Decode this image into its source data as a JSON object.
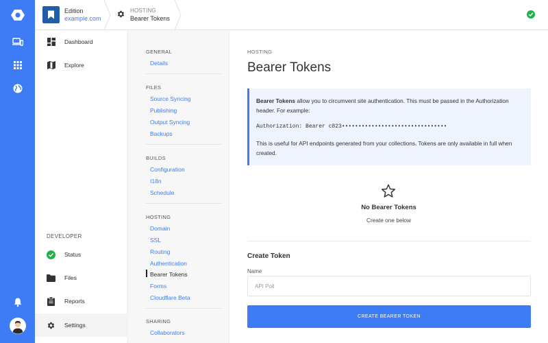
{
  "rail": {
    "icons": [
      "logo-icon",
      "devices-icon",
      "grid-icon",
      "globe-icon",
      "bell-icon",
      "avatar"
    ]
  },
  "topbar": {
    "site_name": "Edition",
    "site_url": "example.com",
    "crumb_section": "HOSTING",
    "crumb_page": "Bearer Tokens",
    "status": "ok"
  },
  "nav": {
    "top_items": [
      {
        "label": "Dashboard",
        "icon": "dashboard-icon"
      },
      {
        "label": "Explore",
        "icon": "map-icon"
      }
    ],
    "developer_heading": "DEVELOPER",
    "developer_items": [
      {
        "label": "Status",
        "icon": "check-circle-icon"
      },
      {
        "label": "Files",
        "icon": "folder-icon"
      },
      {
        "label": "Reports",
        "icon": "clipboard-icon"
      },
      {
        "label": "Settings",
        "icon": "gear-icon",
        "active": true
      }
    ]
  },
  "settings": {
    "groups": [
      {
        "heading": "GENERAL",
        "links": [
          "Details"
        ]
      },
      {
        "heading": "FILES",
        "links": [
          "Source Syncing",
          "Publishing",
          "Output Syncing",
          "Backups"
        ]
      },
      {
        "heading": "BUILDS",
        "links": [
          "Configuration",
          "I18n",
          "Schedule"
        ]
      },
      {
        "heading": "HOSTING",
        "links": [
          "Domain",
          "SSL",
          "Routing",
          "Authentication",
          "Bearer Tokens",
          "Forms",
          "Cloudflare Beta"
        ]
      },
      {
        "heading": "SHARING",
        "links": [
          "Collaborators"
        ]
      }
    ],
    "current": "Bearer Tokens"
  },
  "main": {
    "section": "HOSTING",
    "title": "Bearer Tokens",
    "notice": {
      "bold": "Bearer Tokens",
      "text1": " allow you to circumvent site authentication. This must be passed in the Authorization header. For example:",
      "code": "Authorization: Bearer c823••••••••••••••••••••••••••••••••",
      "text2": "This is useful for API endpoints generated from your collections. Tokens are only available in full when created."
    },
    "empty": {
      "icon": "star-icon",
      "title": "No Bearer Tokens",
      "subtitle": "Create one below"
    },
    "create": {
      "title": "Create Token",
      "name_label": "Name",
      "name_placeholder": "API Poll",
      "button": "CREATE BEARER TOKEN"
    }
  },
  "colors": {
    "accent": "#3d7cf4",
    "success": "#22b14c"
  }
}
